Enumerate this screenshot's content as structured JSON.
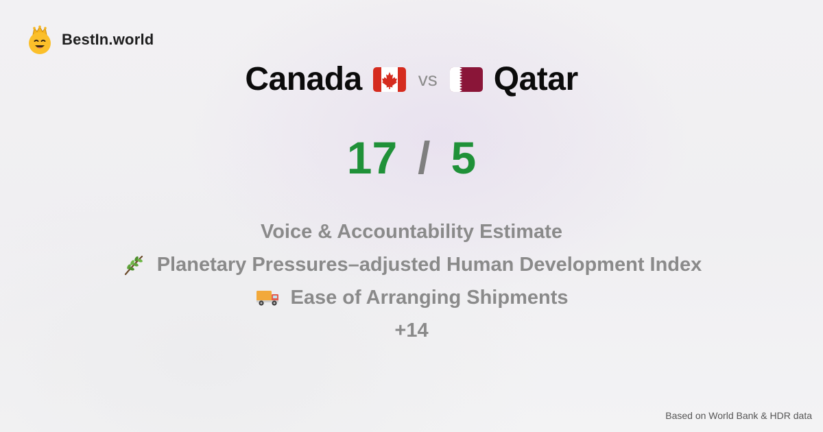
{
  "brand": {
    "name": "BestIn.world",
    "logo_icon": "smiling-crown-emoji-icon"
  },
  "matchup": {
    "left_country": "Canada",
    "left_flag_icon": "canada-flag-icon",
    "vs_label": "vs",
    "right_country": "Qatar",
    "right_flag_icon": "qatar-flag-icon"
  },
  "scores": {
    "left": "17",
    "separator": "/",
    "right": "5"
  },
  "metrics": [
    {
      "label": "Voice & Accountability Estimate",
      "icon": ""
    },
    {
      "label": "Planetary Pressures–adjusted Human Development Index",
      "icon": "herb-icon"
    },
    {
      "label": "Ease of Arranging Shipments",
      "icon": "delivery-truck-icon"
    }
  ],
  "more_count": "+14",
  "footer": "Based on World Bank & HDR data",
  "colors": {
    "score_green": "#1f9138",
    "muted_gray": "#8a8a8a",
    "canada_red": "#d52b1e",
    "qatar_maroon": "#8a1538"
  }
}
